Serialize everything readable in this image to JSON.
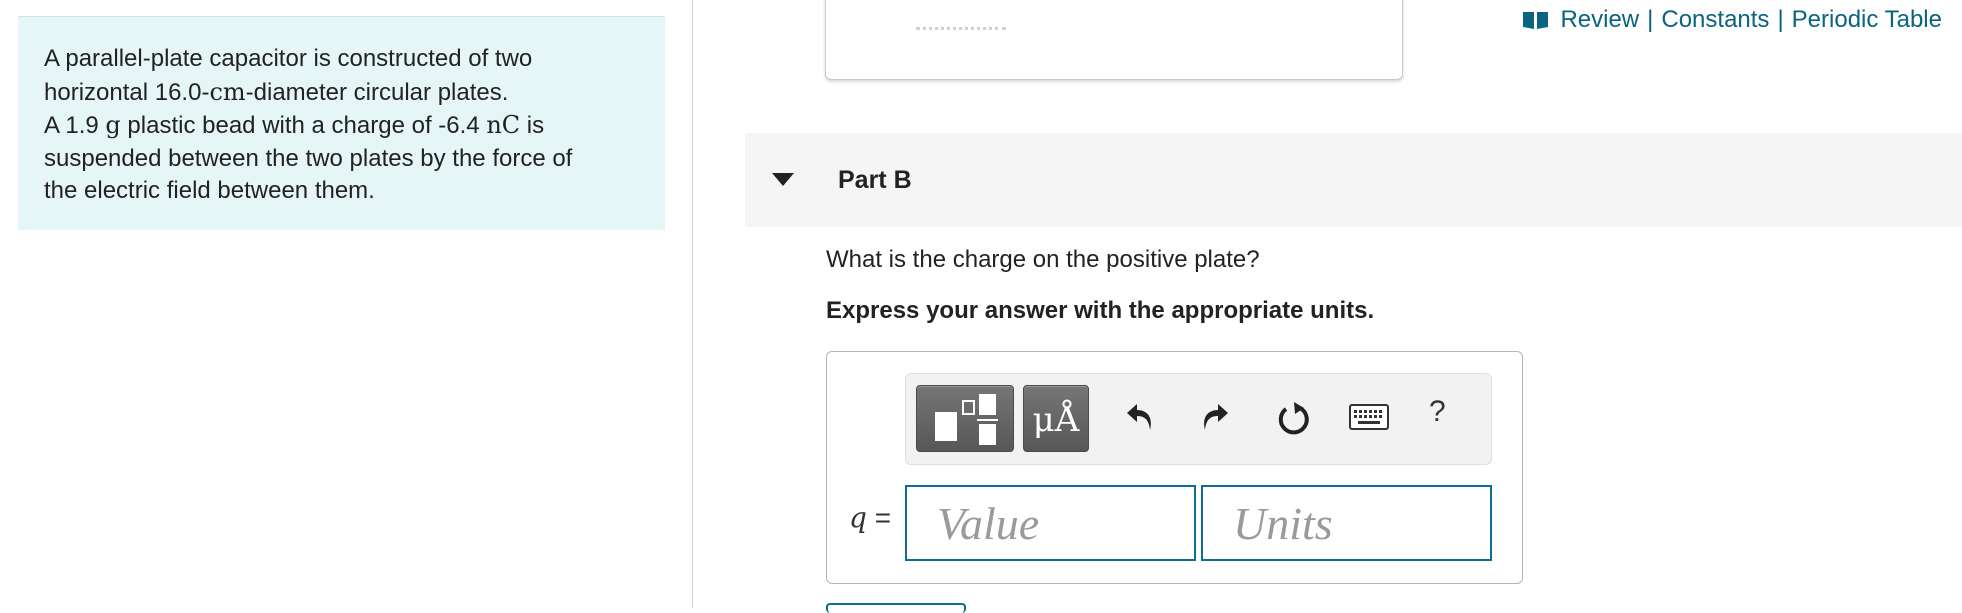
{
  "problem": {
    "line1": "A parallel-plate capacitor is constructed of two",
    "line2_pre": "horizontal 16.0-",
    "line2_unit": "cm",
    "line2_post": "-diameter circular plates.",
    "line3_pre": "A 1.9 ",
    "line3_unit": "g",
    "line3_mid": " plastic bead with a charge of -6.4 ",
    "line3_unit2": "nC",
    "line3_post": " is",
    "line4": "suspended between the two plates by the force of",
    "line5": "the electric field between them."
  },
  "toplinks": {
    "icon": "book-icon",
    "review": "Review",
    "sep1": "|",
    "constants": "Constants",
    "sep2": "|",
    "periodic_table": "Periodic Table"
  },
  "part": {
    "title": "Part B",
    "question": "What is the charge on the positive plate?",
    "instruction": "Express your answer with the appropriate units."
  },
  "toolbar": {
    "templates_icon": "templates-icon",
    "units_label": "μÅ",
    "undo_icon": "undo-icon",
    "redo_icon": "redo-icon",
    "reset_icon": "reset-icon",
    "keyboard_icon": "keyboard-icon",
    "help_label": "?"
  },
  "answer": {
    "variable": "q",
    "equals": " =",
    "value_placeholder": "Value",
    "units_placeholder": "Units"
  },
  "colors": {
    "link": "#0b6281",
    "problem_bg": "#e6f6f6",
    "input_border": "#0d6d93",
    "toolbar_button": "#666666"
  }
}
